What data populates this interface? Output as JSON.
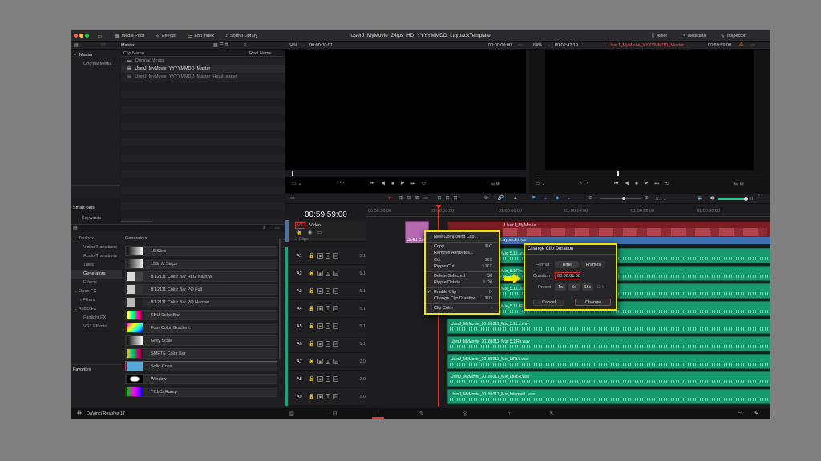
{
  "window": {
    "title": "UserJ_MyMovie_24fps_HD_YYYYMMDD_LaybackTemplate"
  },
  "toolbar": {
    "media_pool": "Media Pool",
    "effects": "Effects",
    "edit_index": "Edit Index",
    "sound_library": "Sound Library",
    "mixer": "Mixer",
    "metadata": "Metadata",
    "inspector": "Inspector"
  },
  "media_pool": {
    "bin_header": "Master",
    "clip_col": "Clip Name",
    "reel_col": "Reel Name",
    "bins": [
      "Master",
      "Original Media"
    ],
    "clips": [
      "Original Media",
      "UserJ_MyMovie_YYYYMMDD_Master",
      "UserJ_MyMovie_YYYYMMDD_Master_HeadLeader"
    ],
    "smart_bins": "Smart Bins",
    "keywords": "Keywords"
  },
  "source_viewer": {
    "zoom": "64%",
    "timecode": "00:00:00:01",
    "end_timecode": "00:00:00:00"
  },
  "timeline_viewer": {
    "zoom": "64%",
    "timecode": "00:02:42:19",
    "timeline_name": "UserJ_MyMovie_YYYYMMDD_Master",
    "end_timecode": "00:59:59:00"
  },
  "effects": {
    "tree": [
      "Toolbox",
      "Video Transitions",
      "Audio Transitions",
      "Titles",
      "Generators",
      "Effects",
      "Open FX",
      "Filters",
      "Audio FX",
      "Fairlight FX",
      "VST Effects"
    ],
    "favorites": "Favorites",
    "generators_header": "Generators",
    "generators": [
      "10 Step",
      "100mV Steps",
      "BT.2111 Color Bar HLG Narrow",
      "BT.2111 Color Bar PQ Full",
      "BT.2111 Color Bar PQ Narrow",
      "EBU Color Bar",
      "Four Color Gradient",
      "Grey Scale",
      "SMPTE Color Bar",
      "Solid Color",
      "Window",
      "YCbCr Ramp"
    ]
  },
  "timeline": {
    "timecode": "00:59:59:00",
    "ruler": [
      "00:59:50:00",
      "01:00:00:00",
      "01:00:06:00",
      "01:00:14:00",
      "01:00:22:00",
      "01:00:30:00"
    ],
    "video_track": {
      "id": "V1",
      "name": "Video",
      "clip_count": "2 Clips"
    },
    "audio_tracks": [
      {
        "id": "A1",
        "fmt": "5.1"
      },
      {
        "id": "A2",
        "fmt": "5.1"
      },
      {
        "id": "A3",
        "fmt": "5.1"
      },
      {
        "id": "A4",
        "fmt": "5.1"
      },
      {
        "id": "A5",
        "fmt": "5.1"
      },
      {
        "id": "A6",
        "fmt": "5.1"
      },
      {
        "id": "A7",
        "fmt": "2.0"
      },
      {
        "id": "A8",
        "fmt": "2.0"
      },
      {
        "id": "A9",
        "fmt": "2.0"
      }
    ],
    "volume": "0"
  },
  "clips": {
    "solid": "Solid Color",
    "video_main": "UserJ_MyMovie",
    "laybackmov": "Layback.mov",
    "audio": [
      "UserJ_MyMovie_20181011_Mix_5.1.L.wav",
      "UserJ_MyMovie_20181011_Mix_5.1.R.wav",
      "UserJ_MyMovie_20181011_Mix_5.1.C.wav",
      "UserJ_MyMovie_20181011_Mix_5.1.LFE.wav",
      "UserJ_MyMovie_20181011_Mix_5.1.Ls.wav",
      "UserJ_MyMovie_20181011_Mix_5.1.Rs.wav",
      "UserJ_MyMovie_20181011_Mix_LtRt.L.wav",
      "UserJ_MyMovie_20181011_Mix_LtRt.R.wav",
      "UserJ_MyMovie_20181011_Mix_Internat.L.wav"
    ]
  },
  "context_menu": {
    "items": [
      {
        "label": "New Compound Clip..."
      },
      {
        "sep": true
      },
      {
        "label": "Copy",
        "sc": "⌘C"
      },
      {
        "label": "Remove Attributes..."
      },
      {
        "label": "Cut",
        "sc": "⌘X"
      },
      {
        "label": "Ripple Cut",
        "sc": "⇧⌘X"
      },
      {
        "sep": true
      },
      {
        "label": "Delete Selected",
        "sc": "⌫"
      },
      {
        "label": "Ripple Delete",
        "sc": "⇧⌫"
      },
      {
        "sep": true
      },
      {
        "label": "Enable Clip",
        "sc": "D",
        "check": "✓"
      },
      {
        "label": "Change Clip Duration...",
        "sc": "⌘D"
      },
      {
        "sep": true
      },
      {
        "label": "Clip Color",
        "sc": "›"
      }
    ]
  },
  "dialog": {
    "title": "Change Clip Duration",
    "format_label": "Format",
    "format_options": [
      "Time",
      "Frames"
    ],
    "duration_label": "Duration",
    "duration_value": "00:00:01:00",
    "preset_label": "Preset",
    "presets": [
      "1s",
      "5s",
      "15s",
      "Grid"
    ],
    "cancel": "Cancel",
    "change": "Change"
  },
  "footer": {
    "app": "DaVinci Resolve 17"
  }
}
